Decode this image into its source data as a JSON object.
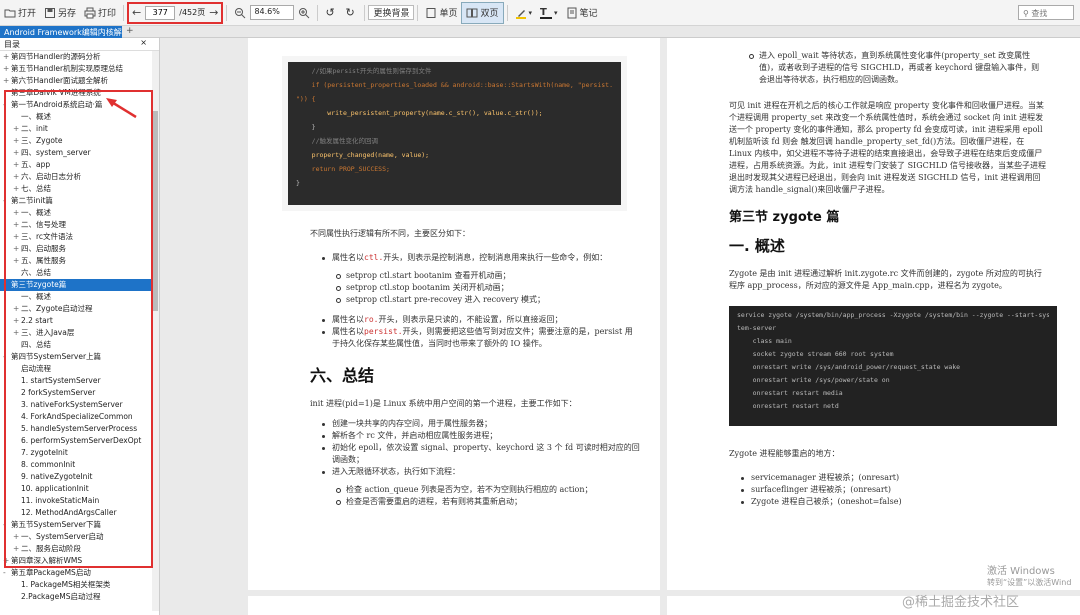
{
  "toolbar": {
    "open": "打开",
    "saveas": "另存",
    "print": "打印",
    "page_current": "377",
    "page_total": "/452页",
    "zoom": "84.6%",
    "bg": "更换背景",
    "single": "单页",
    "double": "双页",
    "notes": "笔记",
    "search": "查找"
  },
  "tab": {
    "title": "Android Framework编辑内核解析",
    "close": "×",
    "add": "+"
  },
  "sidebar": {
    "title": "目录",
    "close": "×",
    "items": [
      {
        "t": "第四节Handler的源码分析",
        "i": 0,
        "g": "+"
      },
      {
        "t": "第五节Handler机制实现原理总结",
        "i": 0,
        "g": "+"
      },
      {
        "t": "第六节Handler面试题全解析",
        "i": 0,
        "g": "+"
      },
      {
        "t": "第三章Dalvik VM进程系统",
        "i": 0,
        "g": ""
      },
      {
        "t": "第一节Android系统启动·篇",
        "i": 0,
        "g": "-"
      },
      {
        "t": "一、概述",
        "i": 1,
        "g": ""
      },
      {
        "t": "二、init",
        "i": 1,
        "g": "+"
      },
      {
        "t": "三、Zygote",
        "i": 1,
        "g": "+"
      },
      {
        "t": "四、system_server",
        "i": 1,
        "g": "+"
      },
      {
        "t": "五、app",
        "i": 1,
        "g": "+"
      },
      {
        "t": "六、启动日志分析",
        "i": 1,
        "g": "+"
      },
      {
        "t": "七、总结",
        "i": 1,
        "g": "+"
      },
      {
        "t": "第二节init篇",
        "i": 0,
        "g": "-"
      },
      {
        "t": "一、概述",
        "i": 1,
        "g": "+"
      },
      {
        "t": "二、信号处理",
        "i": 1,
        "g": "+"
      },
      {
        "t": "三、rc文件语法",
        "i": 1,
        "g": "+"
      },
      {
        "t": "四、启动服务",
        "i": 1,
        "g": "+"
      },
      {
        "t": "五、属性服务",
        "i": 1,
        "g": "+"
      },
      {
        "t": "六、总结",
        "i": 1,
        "g": ""
      },
      {
        "t": "第三节zygote篇",
        "i": 0,
        "g": "-",
        "hl": true
      },
      {
        "t": "一、概述",
        "i": 1,
        "g": ""
      },
      {
        "t": "二、Zygote启动过程",
        "i": 1,
        "g": "+"
      },
      {
        "t": "2.2 start",
        "i": 1,
        "g": "+"
      },
      {
        "t": "三、进入Java层",
        "i": 1,
        "g": "+"
      },
      {
        "t": "四、总结",
        "i": 1,
        "g": ""
      },
      {
        "t": "第四节SystemServer上篇",
        "i": 0,
        "g": "-"
      },
      {
        "t": "启动流程",
        "i": 1,
        "g": ""
      },
      {
        "t": "1. startSystemServer",
        "i": 1,
        "g": ""
      },
      {
        "t": "2 forkSystemServer",
        "i": 1,
        "g": ""
      },
      {
        "t": "3. nativeForkSystemServer",
        "i": 1,
        "g": ""
      },
      {
        "t": "4. ForkAndSpecializeCommon",
        "i": 1,
        "g": ""
      },
      {
        "t": "5. handleSystemServerProcess",
        "i": 1,
        "g": ""
      },
      {
        "t": "6. performSystemServerDexOpt",
        "i": 1,
        "g": ""
      },
      {
        "t": "7. zygoteInit",
        "i": 1,
        "g": ""
      },
      {
        "t": "8. commonInit",
        "i": 1,
        "g": ""
      },
      {
        "t": "9. nativeZygoteInit",
        "i": 1,
        "g": ""
      },
      {
        "t": "10. applicationInit",
        "i": 1,
        "g": ""
      },
      {
        "t": "11. invokeStaticMain",
        "i": 1,
        "g": ""
      },
      {
        "t": "12. MethodAndArgsCaller",
        "i": 1,
        "g": ""
      },
      {
        "t": "第五节SystemServer下篇",
        "i": 0,
        "g": "-"
      },
      {
        "t": "一、SystemServer启动",
        "i": 1,
        "g": "+"
      },
      {
        "t": "二、服务启动阶段",
        "i": 1,
        "g": "+"
      },
      {
        "t": "第四章深入解析WMS",
        "i": 0,
        "g": "+"
      },
      {
        "t": "第五章PackageMS启动",
        "i": 0,
        "g": "-"
      },
      {
        "t": "1. PackageMS相关框架类",
        "i": 1,
        "g": ""
      },
      {
        "t": "2.PackageMS启动过程",
        "i": 1,
        "g": ""
      }
    ]
  },
  "left_page": {
    "code": [
      {
        "c": "c",
        "t": "    //如果persist开头的属性则保存到文件"
      },
      {
        "c": "k",
        "t": "    if (persistent_properties_loaded && android::base::StartsWith(name, \"persist."
      },
      {
        "c": "k",
        "t": "\")) {"
      },
      {
        "c": "n",
        "t": "        write_persistent_property(name.c_str(), value.c_str());"
      },
      {
        "c": "",
        "t": "    }"
      },
      {
        "c": "c",
        "t": "    //触发属性变化的回调"
      },
      {
        "c": "n",
        "t": "    property_changed(name, value);"
      },
      {
        "c": "k",
        "t": "    return PROP_SUCCESS;"
      },
      {
        "c": "",
        "t": "}"
      }
    ],
    "intro": "不同属性执行逻辑有所不同，主要区分如下：",
    "b1_pre": "属性名以",
    "b1_code": "ctl.",
    "b1_post": "开头，则表示是控制消息，控制消息用来执行一些命令，例如：",
    "cmds": [
      "setprop ctl.start bootanim  查看开机动画；",
      "setprop ctl.stop bootanim  关闭开机动画；",
      "setprop ctl.start pre-recovey  进入 recovery 模式；"
    ],
    "b2_pre": "属性名以",
    "b2_code": "ro.",
    "b2_post": "开头，则表示是只读的，不能设置，所以直接返回；",
    "b3_pre": "属性名以",
    "b3_code": "persist.",
    "b3_post": "开头，则需要把这些值写到对应文件；需要注意的是，persist 用于持久化保存某些属性值，当同时也带来了额外的 IO 操作。",
    "h_summary": "六、总结",
    "summary_intro": "init 进程(pid=1)是 Linux 系统中用户空间的第一个进程，主要工作如下：",
    "summary_items": [
      "创建一块共享的内存空间，用于属性服务器；",
      "解析各个 rc 文件，并启动相应属性服务进程；",
      "初始化 epoll，依次设置 signal、property、keychord 这 3 个 fd 可读时相对应的回调函数；",
      "进入无限循环状态，执行如下流程："
    ],
    "sub_items": [
      "检查 action_queue 列表是否为空，若不为空则执行相应的 action；",
      "检查是否需要重启的进程，若有则将其重新启动；"
    ]
  },
  "right_page": {
    "top_bullet": "进入 epoll_wait 等待状态，直到系统属性变化事件(property_set 改变属性值)，或者收到子进程的信号 SIGCHLD，再或者 keychord 键盘输入事件，则会退出等待状态，执行相应的回调函数。",
    "para": "可见 init 进程在开机之后的核心工作就是响应 property 变化事件和回收僵尸进程。当某个进程调用 property_set 来改变一个系统属性值时，系统会通过 socket 向 init 进程发送一个 property 变化的事件通知，那么 property fd 会变成可读，init 进程采用 epoll 机制监听该 fd 则会 触发回调 handle_property_set_fd()方法。回收僵尸进程，在 Linux 内核中，如父进程不等待子进程的结束直接退出，会导致子进程在结束后变成僵尸进程，占用系统资源。为此，init 进程专门安装了 SIGCHLD 信号接收器，当某些子进程退出时发现其父进程已经退出，则会向 init 进程发送 SIGCHLD 信号，init 进程调用回调方法 handle_signal()来回收僵尸子进程。",
    "h_section": "第三节 zygote 篇",
    "h_overview": "一. 概述",
    "zy_intro": "Zygote 是由 init 进程通过解析 init.zygote.rc 文件而创建的，zygote 所对应的可执行程序 app_process，所对应的源文件是 App_main.cpp，进程名为 zygote。",
    "code": [
      "service zygote /system/bin/app_process -Xzygote /system/bin --zygote --start-sys",
      "tem-server",
      "    class main",
      "    socket zygote stream 660 root system",
      "    onrestart write /sys/android_power/request_state wake",
      "    onrestart write /sys/power/state on",
      "    onrestart restart media",
      "    onrestart restart netd"
    ],
    "restart_intro": "Zygote 进程能够重启的地方：",
    "restart_items": [
      "servicemanager 进程被杀；(onresart)",
      "surfaceflinger 进程被杀；(onresart)",
      "Zygote 进程自己被杀；(oneshot=false)"
    ]
  },
  "watermark": {
    "win1": "激活 Windows",
    "win2": "转到“设置”以激活Wind",
    "site": "@稀土掘金技术社区"
  }
}
